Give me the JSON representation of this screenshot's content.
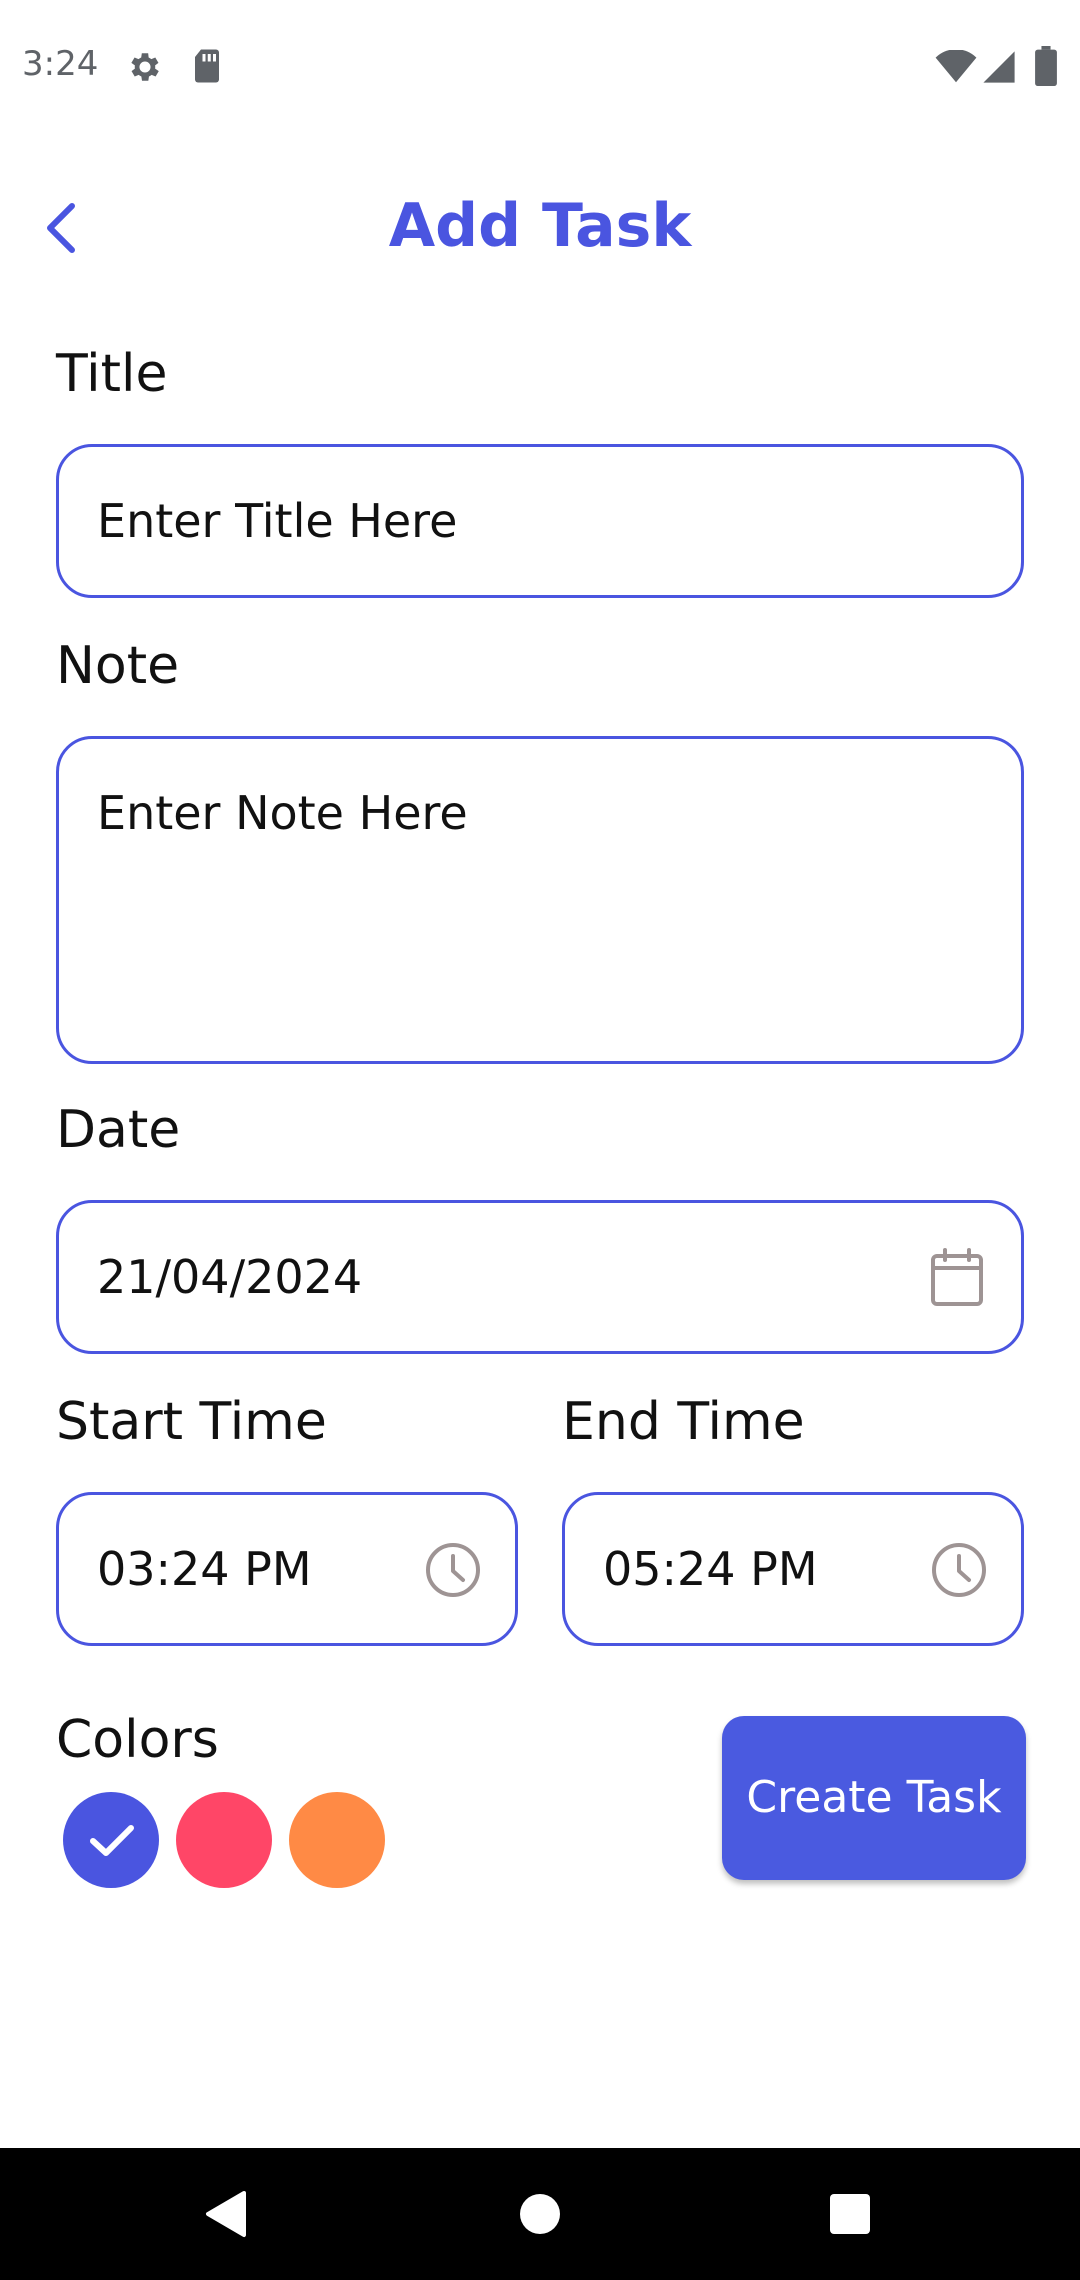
{
  "status_bar": {
    "time": "3:24",
    "icons": [
      "gear-icon",
      "sd-card-icon",
      "wifi-icon",
      "signal-icon",
      "battery-icon"
    ]
  },
  "header": {
    "title": "Add Task",
    "back_icon": "chevron-left-icon"
  },
  "form": {
    "title": {
      "label": "Title",
      "placeholder": "Enter Title Here"
    },
    "note": {
      "label": "Note",
      "placeholder": "Enter Note Here"
    },
    "date": {
      "label": "Date",
      "value": "21/04/2024",
      "icon": "calendar-icon"
    },
    "start_time": {
      "label": "Start Time",
      "value": "03:24 PM",
      "icon": "clock-icon"
    },
    "end_time": {
      "label": "End Time",
      "value": "05:24 PM",
      "icon": "clock-icon"
    },
    "colors": {
      "label": "Colors",
      "options": [
        "#4a55e0",
        "#ff4667",
        "#ff8a45"
      ],
      "selected_index": 0
    },
    "create_button": "Create Task"
  },
  "colors": {
    "accent": "#4a55e0",
    "button": "#4a5ae0"
  },
  "nav_bar": {
    "icons": [
      "back-triangle-icon",
      "home-circle-icon",
      "recents-square-icon"
    ]
  }
}
